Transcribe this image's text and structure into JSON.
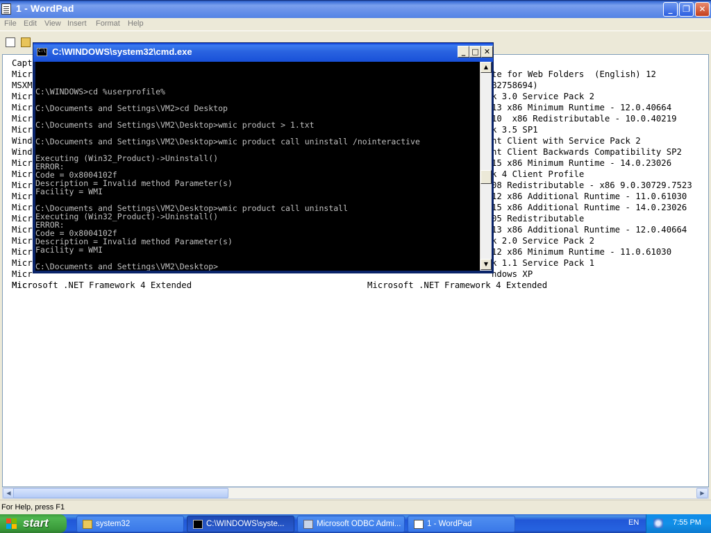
{
  "wordpad": {
    "title": "1 - WordPad",
    "menu": [
      {
        "label": "File"
      },
      {
        "label": "Edit"
      },
      {
        "label": "View"
      },
      {
        "label": "Insert"
      },
      {
        "label": "Format"
      },
      {
        "label": "Help"
      }
    ],
    "document": {
      "left_column": [
        "Capt",
        "Micr",
        "MSXM",
        "Micr",
        "Micr",
        "Micr",
        "Micr",
        "Wind",
        "Wind",
        "Micr",
        "Micr",
        "Micr",
        "Micr",
        "Micr",
        "Micr",
        "Micr",
        "Micr",
        "Micr",
        "Micr",
        "Micr",
        "Micr",
        "Microsoft .NET Framework 4 Extended"
      ],
      "right_column": [
        "te for Web Folders  (English) 12",
        "B2758694)",
        "k 3.0 Service Pack 2",
        "13 x86 Minimum Runtime - 12.0.40664",
        "10  x86 Redistributable - 10.0.40219",
        "k 3.5 SP1",
        "nt Client with Service Pack 2",
        "nt Client Backwards Compatibility SP2",
        "15 x86 Minimum Runtime - 14.0.23026",
        "k 4 Client Profile",
        "08 Redistributable - x86 9.0.30729.7523",
        "12 x86 Additional Runtime - 11.0.61030",
        "15 x86 Additional Runtime - 14.0.23026",
        "05 Redistributable",
        "13 x86 Additional Runtime - 12.0.40664",
        "k 2.0 Service Pack 2",
        "12 x86 Minimum Runtime - 11.0.61030",
        "k 1.1 Service Pack 1",
        "ndows XP",
        "Microsoft .NET Framework 4 Extended"
      ]
    },
    "status": "For Help, press F1"
  },
  "cmd": {
    "title": "C:\\WINDOWS\\system32\\cmd.exe",
    "lines": [
      {
        "row": 0,
        "text": "C:\\WINDOWS>cd %userprofile%"
      },
      {
        "row": 2,
        "text": "C:\\Documents and Settings\\VM2>cd Desktop"
      },
      {
        "row": 4,
        "text": "C:\\Documents and Settings\\VM2\\Desktop>wmic product > 1.txt"
      },
      {
        "row": 6,
        "text": "C:\\Documents and Settings\\VM2\\Desktop>wmic product call uninstall /nointeractive"
      },
      {
        "row": 8,
        "text": "Executing (Win32_Product)->Uninstall()"
      },
      {
        "row": 9,
        "text": "ERROR:"
      },
      {
        "row": 10,
        "text": "Code = 0x8004102f"
      },
      {
        "row": 11,
        "text": "Description = Invalid method Parameter(s)"
      },
      {
        "row": 12,
        "text": "Facility = WMI"
      },
      {
        "row": 14,
        "text": "C:\\Documents and Settings\\VM2\\Desktop>wmic product call uninstall"
      },
      {
        "row": 15,
        "text": "Executing (Win32_Product)->Uninstall()"
      },
      {
        "row": 16,
        "text": "ERROR:"
      },
      {
        "row": 17,
        "text": "Code = 0x8004102f"
      },
      {
        "row": 18,
        "text": "Description = Invalid method Parameter(s)"
      },
      {
        "row": 19,
        "text": "Facility = WMI"
      },
      {
        "row": 21,
        "text": "C:\\Documents and Settings\\VM2\\Desktop>"
      }
    ]
  },
  "taskbar": {
    "start_label": "start",
    "tasks": [
      {
        "label": "system32",
        "icon": "folder-icon"
      },
      {
        "label": "C:\\WINDOWS\\syste...",
        "icon": "cmd-icon"
      },
      {
        "label": "Microsoft ODBC Admi...",
        "icon": "odbc-icon"
      },
      {
        "label": "1 - WordPad",
        "icon": "wordpad-icon"
      }
    ],
    "language": "EN",
    "clock": "7:55 PM"
  },
  "colors": {
    "xp_blue": "#2157d7",
    "start_green": "#3c9a3c",
    "console_bg": "#000000",
    "console_text": "#c0c0c0"
  }
}
